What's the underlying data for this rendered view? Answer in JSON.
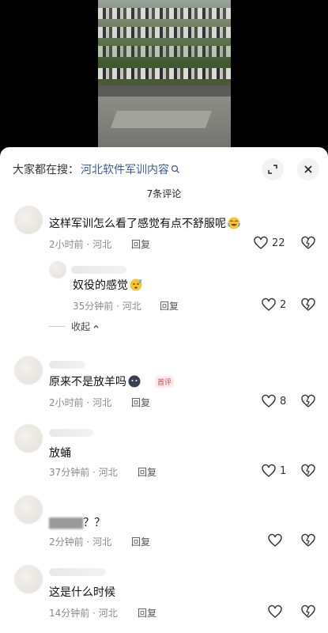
{
  "video": {
    "description_icon": "video-thumbnail"
  },
  "search": {
    "prefix": "大家都在搜：",
    "term": "河北软件军训内容",
    "icon": "search-icon"
  },
  "header": {
    "expand_icon": "expand-icon",
    "close_icon": "close-icon",
    "count": "7条评论"
  },
  "comments": [
    {
      "text": "这样军训怎么看了感觉有点不舒服呢",
      "emoji": "laugh-cry-emoji",
      "time": "2小时前 · 河北",
      "reply": "回复",
      "likes": "22"
    },
    {
      "text": "奴役的感觉",
      "emoji": "sleepy-emoji",
      "time": "35分钟前 · 河北",
      "reply": "回复",
      "likes": "2"
    },
    {
      "text": "原来不是放羊吗",
      "emoji": "face-emoji",
      "tag": "首评",
      "time": "2小时前 · 河北",
      "reply": "回复",
      "likes": "8"
    },
    {
      "text": "放蛹",
      "time": "37分钟前 · 河北",
      "reply": "回复",
      "likes": "1"
    },
    {
      "text": "？？",
      "time": "2分钟前 · 河北",
      "reply": "回复",
      "likes": ""
    },
    {
      "text": "这是什么时候",
      "time": "14分钟前 · 河北",
      "reply": "回复",
      "likes": ""
    }
  ],
  "fold": {
    "label": "收起"
  },
  "colors": {
    "accent": "#3b5b9a",
    "tag": "#e0404a"
  }
}
